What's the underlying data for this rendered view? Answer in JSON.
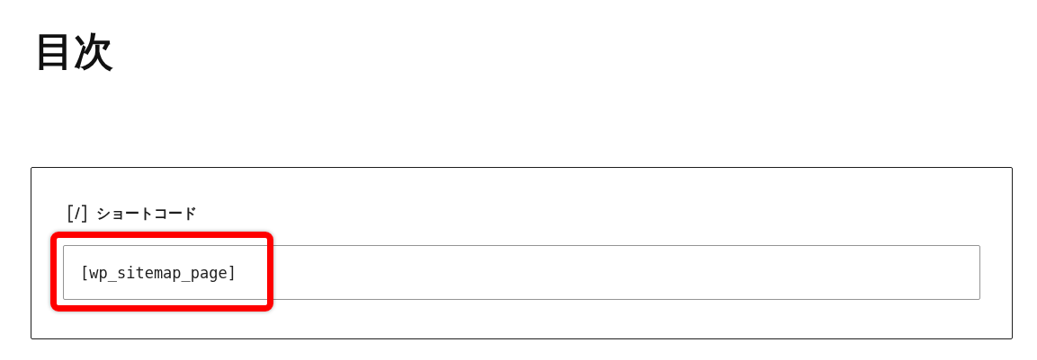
{
  "heading": "目次",
  "block": {
    "label": "ショートコード",
    "field": {
      "value": "[wp_sitemap_page]",
      "highlighted": true
    }
  }
}
